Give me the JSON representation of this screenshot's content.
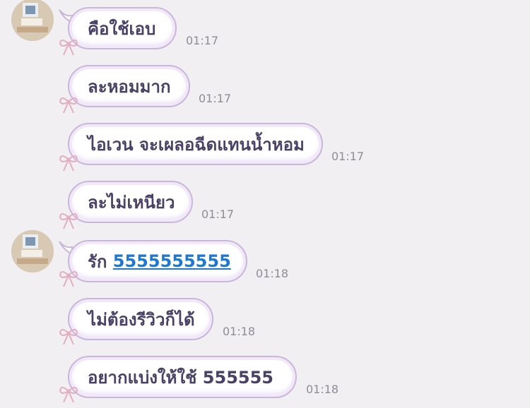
{
  "messages": [
    {
      "text": "คือใช้เอบ",
      "time": "01:17"
    },
    {
      "text": "ละหอมมาก",
      "time": "01:17"
    },
    {
      "text": "ไอเวน จะเผลอฉีดแทนน้ำหอม",
      "time": "01:17"
    },
    {
      "text": "ละไม่เหนียว",
      "time": "01:17"
    },
    {
      "text": "รัก ",
      "link": "5555555555",
      "time": "01:18"
    },
    {
      "text": "ไม่ต้องรีวิวก็ได้",
      "time": "01:18"
    },
    {
      "text": "อยากแบ่งให้ใช้ 555555",
      "time": "01:18"
    }
  ],
  "colors": {
    "link": "#1e78d2",
    "bubble_border": "#c9b6db",
    "text": "#4a4166",
    "background": "#f1eff1"
  }
}
